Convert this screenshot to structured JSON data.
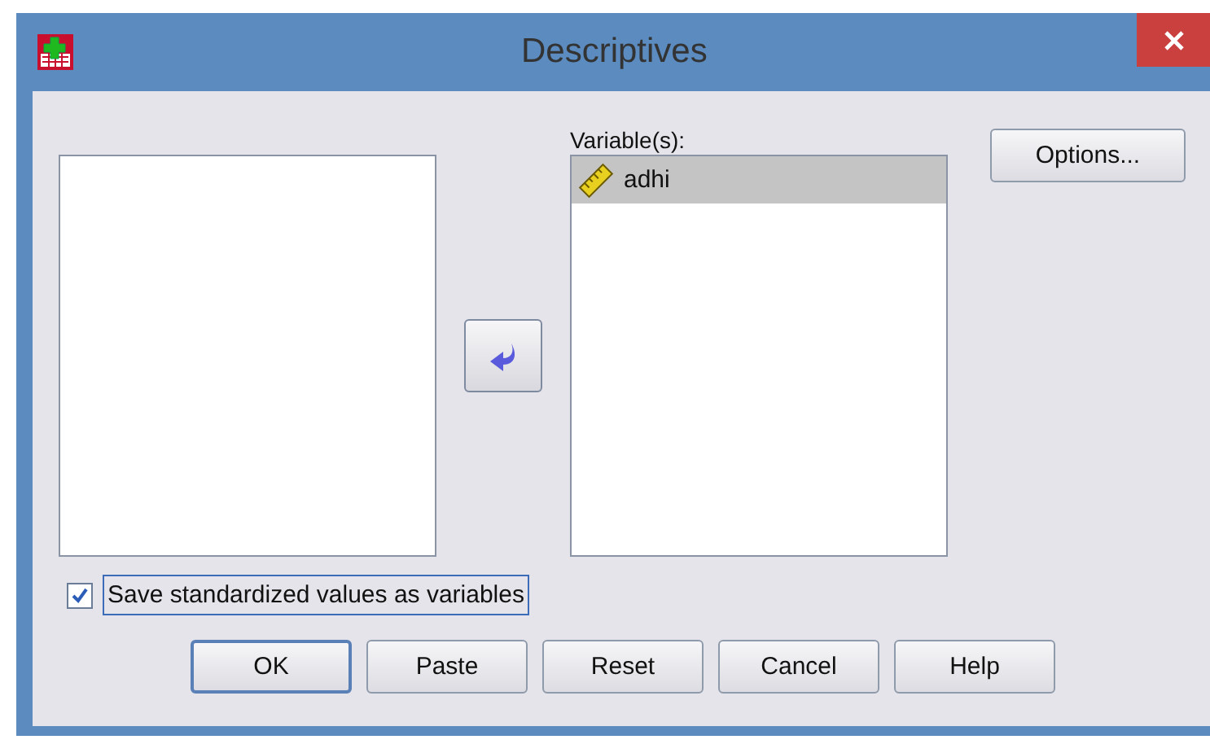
{
  "window": {
    "title": "Descriptives"
  },
  "variables": {
    "label": "Variable(s):",
    "items": [
      {
        "name": "adhi",
        "selected": true
      }
    ]
  },
  "options_button": "Options...",
  "save_checkbox": {
    "label": "Save standardized values as variables",
    "checked": true
  },
  "buttons": [
    {
      "label": "OK",
      "default": true
    },
    {
      "label": "Paste",
      "default": false
    },
    {
      "label": "Reset",
      "default": false
    },
    {
      "label": "Cancel",
      "default": false
    },
    {
      "label": "Help",
      "default": false
    }
  ]
}
